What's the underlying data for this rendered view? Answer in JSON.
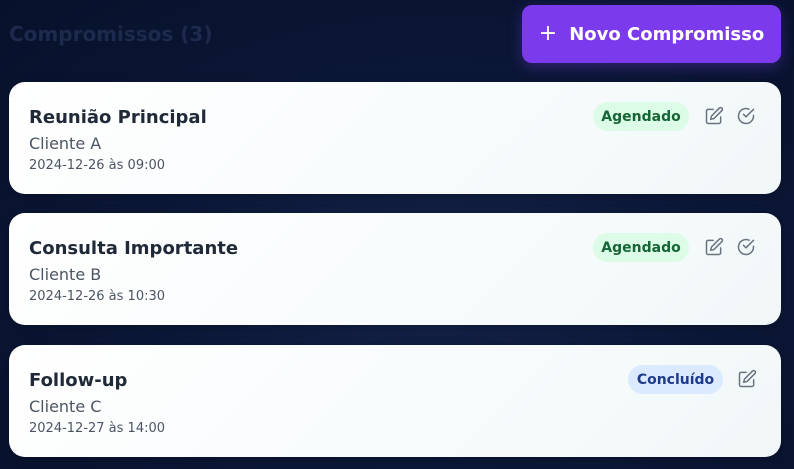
{
  "header": {
    "title": "Compromissos (3)",
    "new_button_label": "Novo Compromisso",
    "new_button_icon": "plus-icon"
  },
  "appointments": [
    {
      "title": "Reunião Principal",
      "client": "Cliente A",
      "datetime": "2024-12-26 às 09:00",
      "status": "Agendado",
      "status_color": "#166534",
      "actions": [
        "edit-icon",
        "check-circle-icon"
      ]
    },
    {
      "title": "Consulta Importante",
      "client": "Cliente B",
      "datetime": "2024-12-26 às 10:30",
      "status": "Agendado",
      "status_color": "#166534",
      "actions": [
        "edit-icon",
        "check-circle-icon"
      ]
    },
    {
      "title": "Follow-up",
      "client": "Cliente C",
      "datetime": "2024-12-27 às 14:00",
      "status": "Concluído",
      "status_color": "#1e3a8a",
      "actions": [
        "edit-icon"
      ]
    }
  ],
  "colors": {
    "accent": "#7c3aed",
    "background": "#0c1838",
    "badge_scheduled_bg": "#dcfce7",
    "badge_done_bg": "#dbeafe"
  }
}
